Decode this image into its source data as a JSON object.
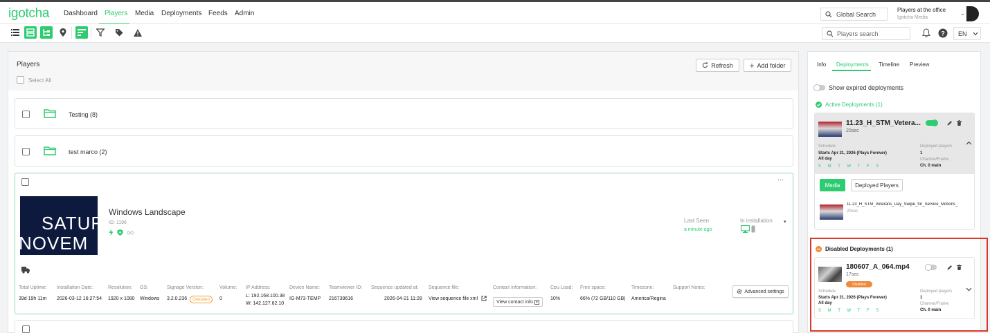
{
  "app": {
    "logo": "igotcha",
    "nav": [
      "Dashboard",
      "Players",
      "Media",
      "Deployments",
      "Feeds",
      "Admin"
    ],
    "active_nav": "Players",
    "global_search_placeholder": "Global Search",
    "office_name": "Players at the office",
    "office_org": "Igotcha Media",
    "accent": "#2ecc71"
  },
  "toolbar": {
    "icons": [
      "list-icon",
      "grid-icon",
      "tree-icon",
      "map-pin-icon",
      "sort-icon",
      "filter-icon",
      "tag-icon",
      "warning-icon"
    ],
    "players_search_placeholder": "Players search",
    "language": "EN"
  },
  "players": {
    "title": "Players",
    "select_all": "Select All",
    "refresh": "Refresh",
    "add_folder": "Add folder",
    "folders": [
      {
        "name": "Testing (8)"
      },
      {
        "name": "test marco (2)"
      }
    ],
    "player": {
      "thumbnail_text": [
        "SATUR",
        "NOVEM"
      ],
      "name": "Windows Landscape",
      "id": "ID: 1196",
      "last_seen_label": "Last Seen",
      "last_seen_value": "a minute ago",
      "install_label": "In installation",
      "more": "...",
      "stats": {
        "total_uptime": {
          "label": "Total Uptime:",
          "value": "39d 19h 11m"
        },
        "install_date": {
          "label": "Installation Date:",
          "value": "2026-03-12 16:27:54"
        },
        "resolution": {
          "label": "Resolution:",
          "value": "1920 x 1080"
        },
        "os": {
          "label": "OS:",
          "value": "Windows"
        },
        "signage_version": {
          "label": "Signage Version:",
          "value": "3.2.0.236",
          "badge": "Outdated"
        },
        "volume": {
          "label": "Volume:",
          "value": "0"
        },
        "ip": {
          "label": "IP Address:",
          "value_l": "L: 192.168.100.38",
          "value_w": "W: 142.127.62.10"
        },
        "device_name": {
          "label": "Device Name:",
          "value": "IG-M73-TEMP"
        },
        "teamviewer": {
          "label": "Teamviewer ID:",
          "value": "216739616"
        },
        "sequence_updated": {
          "label": "Sequence updated at:",
          "value": "2026-04-21 11:28"
        },
        "sequence_file": {
          "label": "Sequence file:",
          "value": "View sequence file xml"
        },
        "contact": {
          "label": "Contact Information:",
          "value": "View contact info"
        },
        "cpu": {
          "label": "Cpu Load:",
          "value": "10%"
        },
        "free_space": {
          "label": "Free space:",
          "value": "66% (72 GB/110 GB)"
        },
        "timezone": {
          "label": "Timezone:",
          "value": "America/Regina"
        },
        "support_notes": {
          "label": "Support Notes:",
          "value": ""
        }
      },
      "advanced_settings": "Advanced settings"
    }
  },
  "right_panel": {
    "tabs": [
      "Info",
      "Deployments",
      "Timeline",
      "Preview"
    ],
    "active_tab": "Deployments",
    "show_expired": "Show expired deployments",
    "active_title": "Active Deployments (1)",
    "active": {
      "name": "11.23_H_STM_Vetera...",
      "duration": "20sec",
      "enabled": true,
      "schedule_label": "Schedule",
      "schedule_value": "Starts Apr 21, 2026 (Plays Forever)",
      "schedule_time": "All day",
      "days": "S M T W T F S",
      "deployed_players_label": "Deployed players",
      "deployed_players_value": "1",
      "channel_label": "Channel/Frame",
      "channel_value": "Ch. 0 main",
      "media_btn": "Media",
      "deployed_players_btn": "Deployed Players",
      "media_item_name": "11.23_H_STM_Veterans_Day_Swipe_for_Service_Motions_",
      "media_item_duration": "20sec"
    },
    "disabled_title": "Disabled Deployments (1)",
    "disabled": {
      "name": "180607_A_064.mp4",
      "duration": "17sec",
      "badge": "Disabled",
      "enabled": false,
      "schedule_label": "Schedule",
      "schedule_value": "Starts Apr 21, 2026 (Plays Forever)",
      "schedule_time": "All day",
      "days": "S M T W T F S",
      "deployed_players_label": "Deployed players",
      "deployed_players_value": "1",
      "channel_label": "Channel/Frame",
      "channel_value": "Ch. 0 main"
    },
    "highlight_color": "#d9372b",
    "disabled_color": "#f08a3b"
  }
}
